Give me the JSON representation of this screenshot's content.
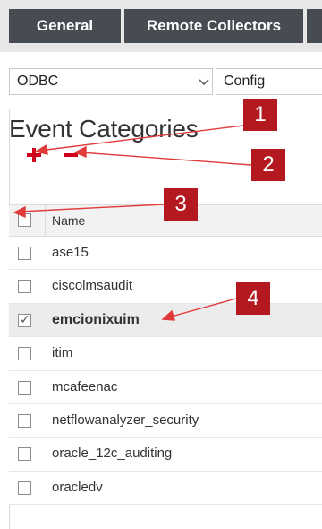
{
  "tabs": {
    "general": "General",
    "remote_collectors": "Remote Collectors"
  },
  "selects": {
    "source": "ODBC",
    "mode": "Config"
  },
  "panel": {
    "title": "Event Categories",
    "column_name": "Name"
  },
  "rows": [
    {
      "name": "ase15",
      "checked": false
    },
    {
      "name": "ciscolmsaudit",
      "checked": false
    },
    {
      "name": "emcionixuim",
      "checked": true
    },
    {
      "name": "itim",
      "checked": false
    },
    {
      "name": "mcafeenac",
      "checked": false
    },
    {
      "name": "netflowanalyzer_security",
      "checked": false
    },
    {
      "name": "oracle_12c_auditing",
      "checked": false
    },
    {
      "name": "oracledv",
      "checked": false
    }
  ],
  "callouts": [
    "1",
    "2",
    "3",
    "4"
  ],
  "colors": {
    "tab_bg": "#474b52",
    "callout_bg": "#b3191f",
    "add_icon": "#d0021b",
    "arrow": "#e03a3a"
  },
  "icons": {
    "add": "add-icon",
    "remove": "remove-icon",
    "dropdown": "chevron-down-icon"
  }
}
